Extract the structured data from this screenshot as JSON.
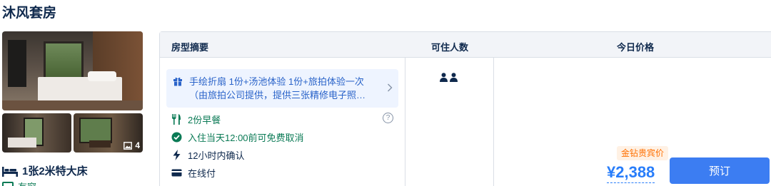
{
  "room": {
    "title": "沐风套房",
    "photo_count": "4",
    "bed": "1张2米特大床",
    "window": "有窗"
  },
  "table": {
    "headers": {
      "summary": "房型摘要",
      "occupancy": "可住人数",
      "price": "今日价格"
    }
  },
  "rate": {
    "package_line1": "手绘折扇 1份+汤池体验 1份+旅拍体验一次",
    "package_line2": "（由旅拍公司提供，提供三张精修电子照…",
    "breakfast": "2份早餐",
    "cancellation": "入住当天12:00前可免费取消",
    "confirmation": "12小时内确认",
    "payment": "在线付",
    "guests": 2,
    "badge": "金钻贵宾价",
    "price": "¥2,388",
    "book_label": "预订"
  },
  "icons": {
    "photo": "image-icon",
    "bed": "bed-icon",
    "window": "window-icon",
    "gift": "gift-icon",
    "chevron": "chevron-right-icon",
    "breakfast": "fork-knife-icon",
    "help": "question-icon",
    "cancel": "check-circle-icon",
    "confirm": "lightning-icon",
    "pay": "card-icon",
    "guest": "person-icon"
  },
  "colors": {
    "primary": "#3c7df2",
    "price": "#287dfa",
    "green": "#0a7a55",
    "badge_bg": "#fff1e4",
    "badge_text": "#ff6f00",
    "package_bg": "#eef4ff",
    "header_bg": "#f2f4f8"
  }
}
